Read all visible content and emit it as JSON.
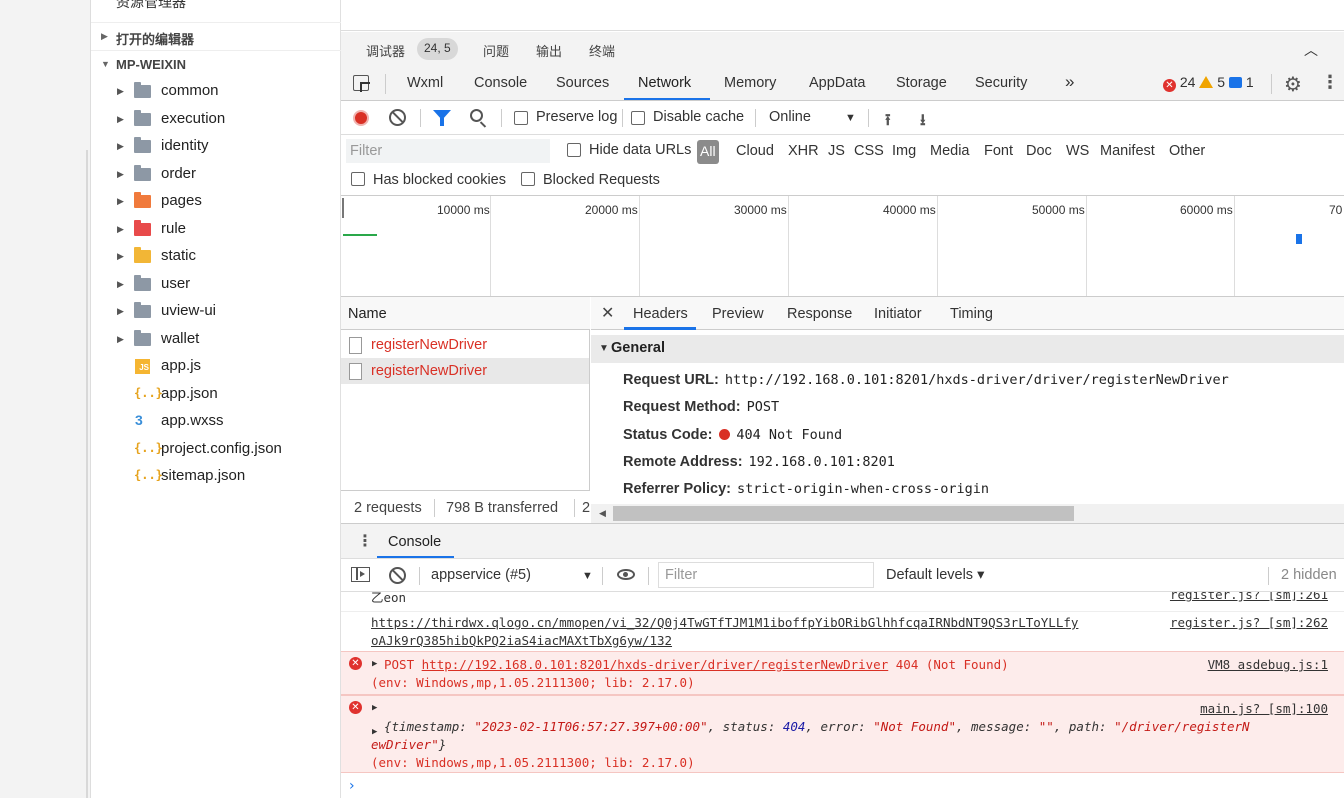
{
  "explorer": {
    "top_title": "资源管理器",
    "top_dots": "···",
    "open_editors": "打开的编辑器",
    "project": "MP-WEIXIN",
    "items": [
      {
        "name": "common",
        "kind": "folder",
        "color": "gray"
      },
      {
        "name": "execution",
        "kind": "folder",
        "color": "gray"
      },
      {
        "name": "identity",
        "kind": "folder",
        "color": "gray"
      },
      {
        "name": "order",
        "kind": "folder",
        "color": "gray"
      },
      {
        "name": "pages",
        "kind": "folder",
        "color": "orange"
      },
      {
        "name": "rule",
        "kind": "folder",
        "color": "red"
      },
      {
        "name": "static",
        "kind": "folder",
        "color": "yellow"
      },
      {
        "name": "user",
        "kind": "folder",
        "color": "gray"
      },
      {
        "name": "uview-ui",
        "kind": "folder",
        "color": "gray"
      },
      {
        "name": "wallet",
        "kind": "folder",
        "color": "gray"
      },
      {
        "name": "app.js",
        "kind": "js-file"
      },
      {
        "name": "app.json",
        "kind": "json-file"
      },
      {
        "name": "app.wxss",
        "kind": "css-file"
      },
      {
        "name": "project.config.json",
        "kind": "json-file"
      },
      {
        "name": "sitemap.json",
        "kind": "json-file"
      }
    ]
  },
  "panel_tabs": {
    "debugger": "调试器",
    "debugger_badge": "24, 5",
    "problems": "问题",
    "output": "输出",
    "terminal": "终端"
  },
  "devtools_tabs": [
    "Wxml",
    "Console",
    "Sources",
    "Network",
    "Memory",
    "AppData",
    "Storage",
    "Security",
    "»"
  ],
  "active_tab": "Network",
  "status": {
    "errors": "24",
    "warnings": "5",
    "messages": "1"
  },
  "toolbar": {
    "preserve_log": "Preserve log",
    "disable_cache": "Disable cache",
    "throttle": "Online"
  },
  "filter": {
    "placeholder": "Filter",
    "hide_data_urls": "Hide data URLs",
    "types": [
      "All",
      "Cloud",
      "XHR",
      "JS",
      "CSS",
      "Img",
      "Media",
      "Font",
      "Doc",
      "WS",
      "Manifest",
      "Other"
    ],
    "has_blocked_cookies": "Has blocked cookies",
    "blocked_requests": "Blocked Requests"
  },
  "timeline": {
    "ticks": [
      "10000 ms",
      "20000 ms",
      "30000 ms",
      "40000 ms",
      "50000 ms",
      "60000 ms",
      "70"
    ]
  },
  "requests": {
    "header": "Name",
    "rows": [
      "registerNewDriver",
      "registerNewDriver"
    ],
    "footer_count": "2 requests",
    "footer_transferred": "798 B transferred",
    "footer_more": "2"
  },
  "details": {
    "tabs": [
      "Headers",
      "Preview",
      "Response",
      "Initiator",
      "Timing"
    ],
    "general_label": "General",
    "fields": [
      {
        "key": "Request URL:",
        "value": "http://192.168.0.101:8201/hxds-driver/driver/registerNewDriver"
      },
      {
        "key": "Request Method:",
        "value": "POST"
      },
      {
        "key": "Status Code:",
        "value": "404 Not Found"
      },
      {
        "key": "Remote Address:",
        "value": "192.168.0.101:8201"
      },
      {
        "key": "Referrer Policy:",
        "value": "strict-origin-when-cross-origin"
      }
    ]
  },
  "console": {
    "tab": "Console",
    "context": "appservice (#5)",
    "filter_placeholder": "Filter",
    "levels": "Default levels ▾",
    "hidden": "2 hidden",
    "log": {
      "line0_text": "乙eon",
      "line0_src": "register.js? [sm]:261",
      "line1_url_a": "https://thirdwx.qlogo.cn/mmopen/vi_32/Q0j4TwGTfTJM1M1iboffpYibORibGlhhfcqaIRNbdNT9QS3rLToYLLfy",
      "line1_url_b": "oAJk9rQ385hibQkPQ2iaS4iacMAXtTbXg6yw/132",
      "line1_src": "register.js? [sm]:262",
      "err1_method": "POST",
      "err1_url": "http://192.168.0.101:8201/hxds-driver/driver/registerNewDriver",
      "err1_status": "404 (Not Found)",
      "err1_src": "VM8 asdebug.js:1",
      "err1_env": "(env: Windows,mp,1.05.2111300; lib: 2.17.0)",
      "err2_src": "main.js? [sm]:100",
      "err2_timestamp": "\"2023-02-11T06:57:27.397+00:00\"",
      "err2_status": "404",
      "err2_error": "\"Not Found\"",
      "err2_message": "\"\"",
      "err2_path_a": "\"/driver/registerN",
      "err2_path_b": "ewDriver\"",
      "err2_env": "(env: Windows,mp,1.05.2111300; lib: 2.17.0)"
    }
  }
}
